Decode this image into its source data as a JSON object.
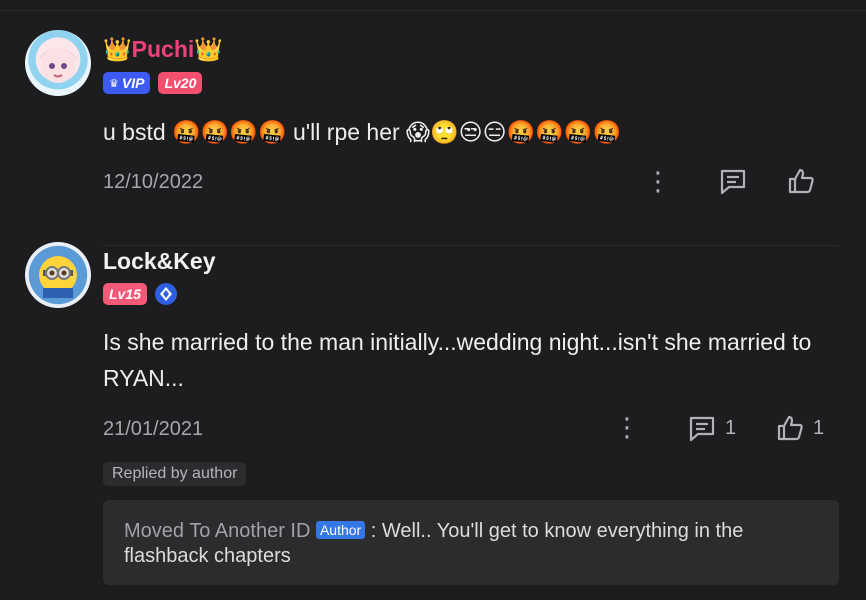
{
  "comments": [
    {
      "username": "Puchi",
      "crown_left": "👑",
      "crown_right": "👑",
      "badges": {
        "vip": "VIP",
        "level": "Lv20"
      },
      "text": "u bstd 🤬🤬🤬🤬 u'll rpe her 😱🙄😒😑🤬🤬🤬🤬",
      "date": "12/10/2022",
      "reply_count": "",
      "like_count": ""
    },
    {
      "username": "Lock&Key",
      "badges": {
        "level": "Lv15"
      },
      "text": "Is she married to the man initially...wedding night...isn't she married to RYAN...",
      "date": "21/01/2021",
      "reply_count": "1",
      "like_count": "1",
      "replied_by_author": "Replied by author",
      "author_reply": {
        "user": "Moved To Another ID",
        "tag": "Author",
        "text": " : Well.. You'll get to know everything in the flashback chapters"
      }
    }
  ],
  "icons": {
    "more": "more-vertical-icon",
    "reply": "comment-icon",
    "like": "thumbs-up-icon",
    "verified": "verified-icon"
  },
  "colors": {
    "background": "#1d1d1f",
    "username_vip": "#f0407a",
    "vip_badge": "#3d5bf2",
    "level_badge": "#f2506e",
    "author_tag": "#3377e8"
  }
}
